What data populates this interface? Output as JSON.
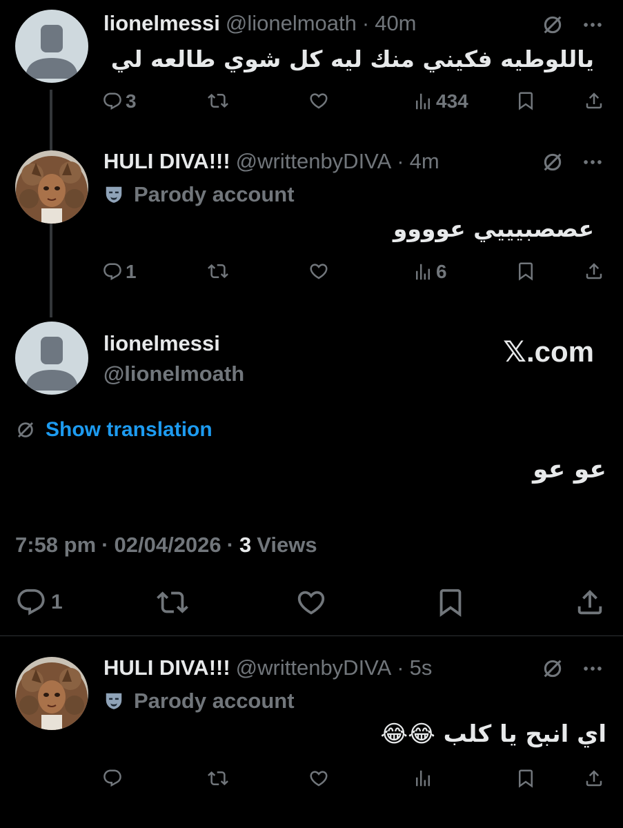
{
  "tweets": [
    {
      "name": "lionelmessi",
      "handle": "@lionelmoath",
      "time": "40m",
      "text": "ياللوطيه فكيني منك ليه كل شوي طالعه لي",
      "replies": "3",
      "views": "434"
    },
    {
      "name": "HULI DIVA!!!",
      "handle": "@writtenbyDIVA",
      "time": "4m",
      "badge": "Parody account",
      "text": "عصصبيييي عوووو",
      "replies": "1",
      "views": "6"
    }
  ],
  "main": {
    "name": "lionelmessi",
    "handle": "@lionelmoath",
    "site": "𝕏.com",
    "translate": "Show translation",
    "text": "عو عو",
    "time": "7:58 pm",
    "date": "02/04/2026",
    "views_count": "3",
    "views_label": "Views",
    "replies": "1"
  },
  "reply": {
    "name": "HULI DIVA!!!",
    "handle": "@writtenbyDIVA",
    "time": "5s",
    "badge": "Parody account",
    "text": "اي انبح يا كلب 😂😂"
  },
  "separator": "·",
  "colors": {
    "background": "#000000",
    "text": "#e7e9ea",
    "muted": "#71767b",
    "link": "#1d9bf0"
  }
}
